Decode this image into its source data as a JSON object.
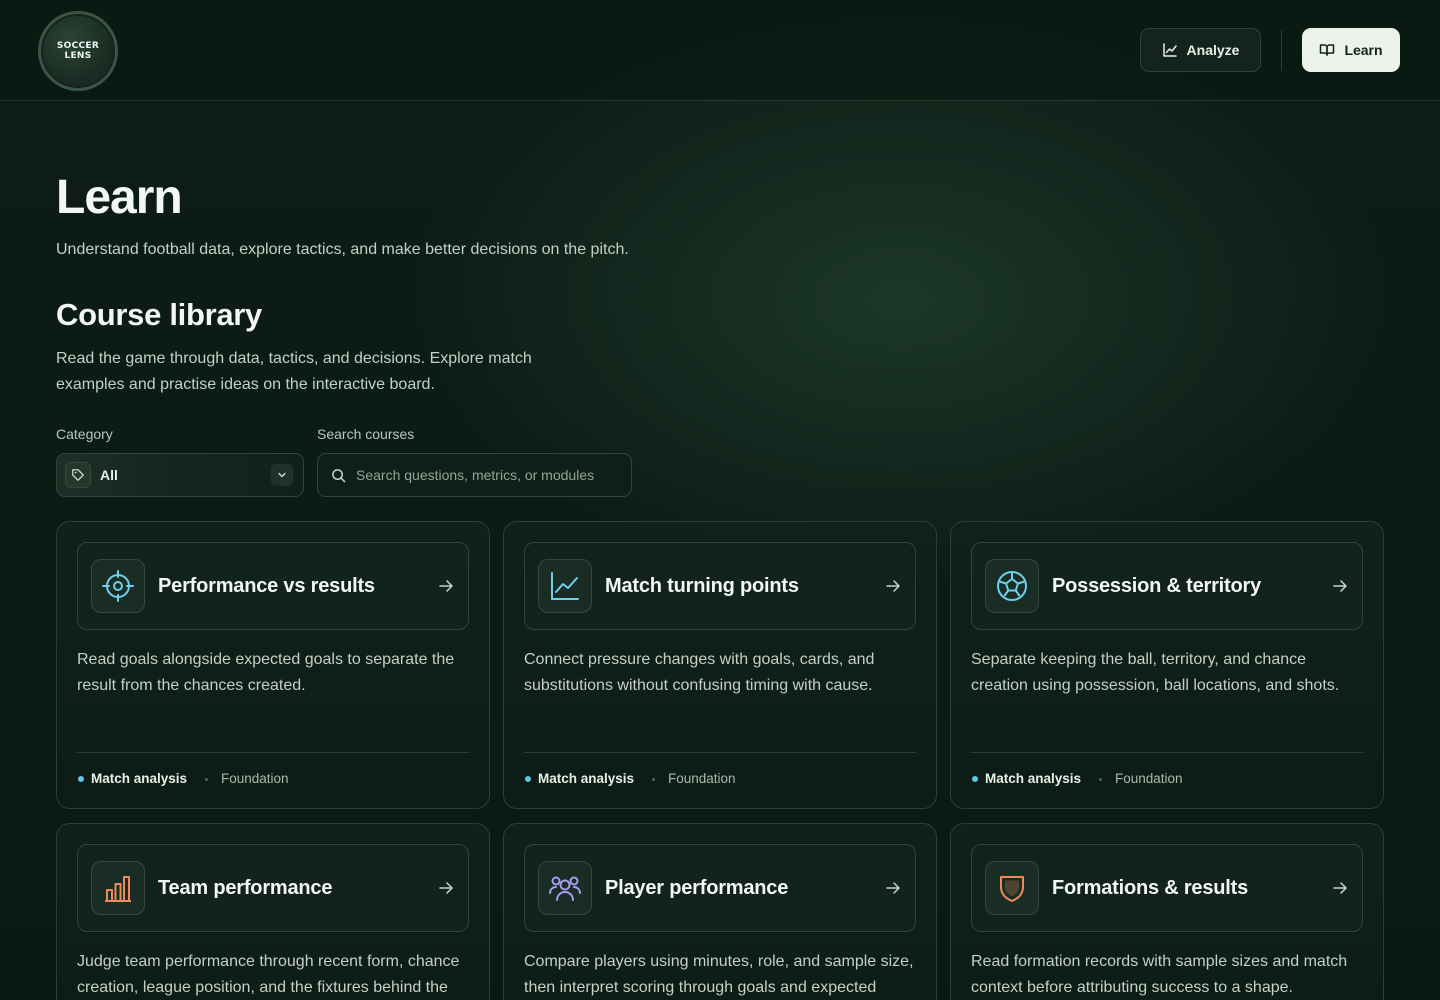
{
  "header": {
    "logo_line1": "SOCCER",
    "logo_line2": "LENS",
    "nav": {
      "analyze_label": "Analyze",
      "learn_label": "Learn"
    }
  },
  "hero": {
    "title": "Learn",
    "subtitle": "Understand football data, explore tactics, and make better decisions on the pitch."
  },
  "library": {
    "title": "Course library",
    "description": "Read the game through data, tactics, and decisions. Explore match examples and practise ideas on the interactive board."
  },
  "filters": {
    "category_label": "Category",
    "category_value": "All",
    "search_label": "Search courses",
    "search_placeholder": "Search questions, metrics, or modules",
    "search_value": ""
  },
  "cards": [
    {
      "title": "Performance vs results",
      "description": "Read goals alongside expected goals to separate the result from the chances created.",
      "tag": "Match analysis",
      "level": "Foundation",
      "icon": "target-icon",
      "icon_color": "#6fd0ee"
    },
    {
      "title": "Match turning points",
      "description": "Connect pressure changes with goals, cards, and substitutions without confusing timing with cause.",
      "tag": "Match analysis",
      "level": "Foundation",
      "icon": "trend-chart-icon",
      "icon_color": "#6fd0ee"
    },
    {
      "title": "Possession & territory",
      "description": "Separate keeping the ball, territory, and chance creation using possession, ball locations, and shots.",
      "tag": "Match analysis",
      "level": "Foundation",
      "icon": "soccer-ball-icon",
      "icon_color": "#6fd0ee"
    },
    {
      "title": "Team performance",
      "description": "Judge team performance through recent form, chance creation, league position, and the fixtures behind the",
      "icon": "bar-chart-icon",
      "icon_color": "#f08a5d"
    },
    {
      "title": "Player performance",
      "description": "Compare players using minutes, role, and sample size, then interpret scoring through goals and expected",
      "icon": "players-icon",
      "icon_color": "#a89cf0"
    },
    {
      "title": "Formations & results",
      "description": "Read formation records with sample sizes and match context before attributing success to a shape.",
      "icon": "shield-icon",
      "icon_color": "#f08a5d"
    }
  ],
  "colors": {
    "background": "#0c1a14",
    "accent_blue": "#62c4e8",
    "accent_orange": "#f08a5d",
    "accent_purple": "#a89cf0",
    "learn_button_bg": "#eaf2ea"
  }
}
